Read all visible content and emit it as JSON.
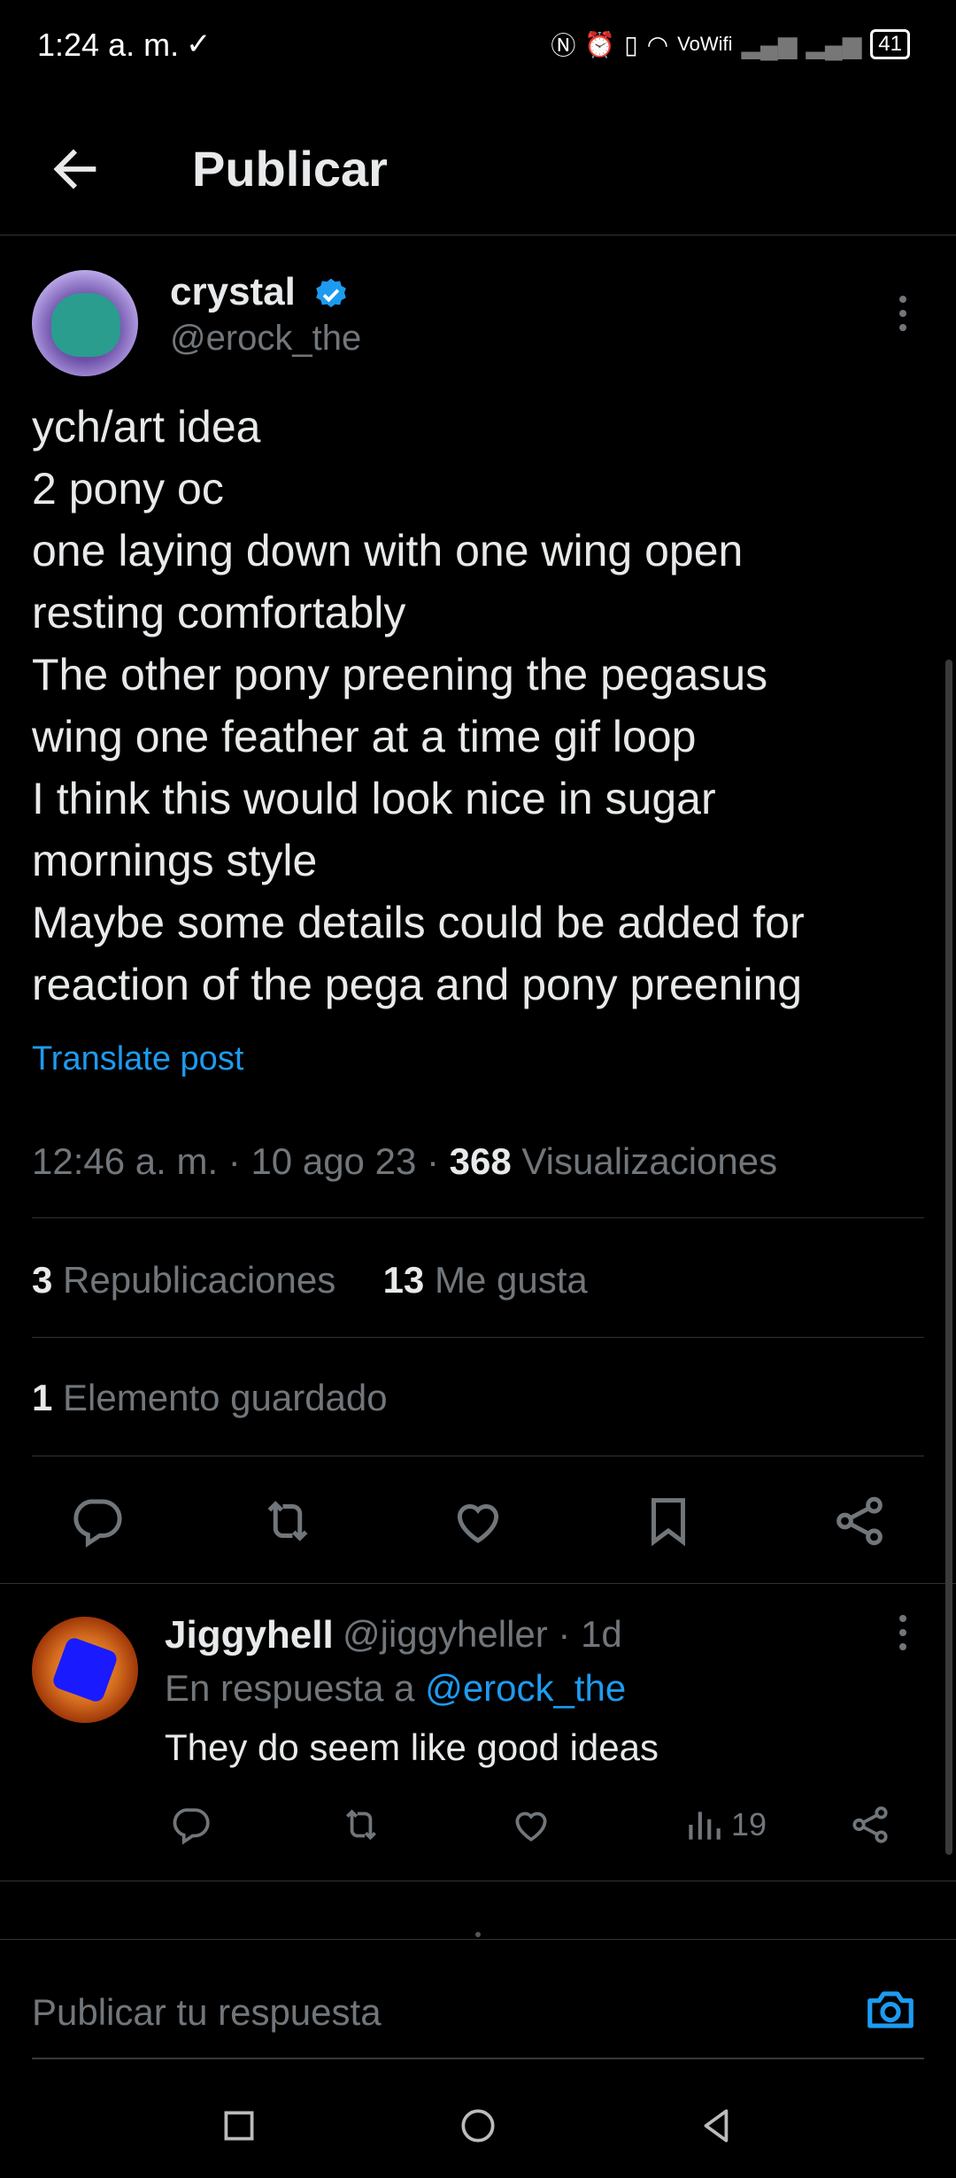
{
  "status_bar": {
    "time": "1:24 a. m.",
    "vowifi": "VoWifi",
    "battery": "41"
  },
  "header": {
    "title": "Publicar"
  },
  "post": {
    "author_name": "crystal",
    "author_handle": "@erock_the",
    "text_lines": [
      "ych/art idea",
      "2 pony oc",
      "one laying down with one wing open",
      "resting comfortably",
      "The other pony preening the pegasus",
      "wing one feather at a time gif loop",
      "I think this would look nice in sugar",
      "mornings style",
      "Maybe some details could be added for",
      "reaction of the pega and pony preening"
    ],
    "translate_label": "Translate post",
    "time": "12:46 a. m.",
    "date": "10 ago 23",
    "views_count": "368",
    "views_label": "Visualizaciones",
    "reposts_count": "3",
    "reposts_label": "Republicaciones",
    "likes_count": "13",
    "likes_label": "Me gusta",
    "bookmarks_count": "1",
    "bookmarks_label": "Elemento guardado"
  },
  "reply": {
    "name": "Jiggyhell",
    "handle_time": "@jiggyheller · 1d",
    "replying_to_label": "En respuesta a",
    "replying_to_handle": "@erock_the",
    "text": "They do seem like good ideas",
    "views": "19"
  },
  "composer": {
    "placeholder": "Publicar tu respuesta"
  },
  "colors": {
    "accent": "#1d9bf0",
    "muted": "#71767b",
    "text": "#e7e9ea",
    "background": "#000000"
  },
  "icons": [
    "back-arrow-icon",
    "verified-badge-icon",
    "more-vertical-icon",
    "reply-icon",
    "repost-icon",
    "like-icon",
    "bookmark-icon",
    "share-icon",
    "views-icon",
    "camera-icon",
    "recent-apps-icon",
    "home-icon",
    "back-nav-icon"
  ]
}
